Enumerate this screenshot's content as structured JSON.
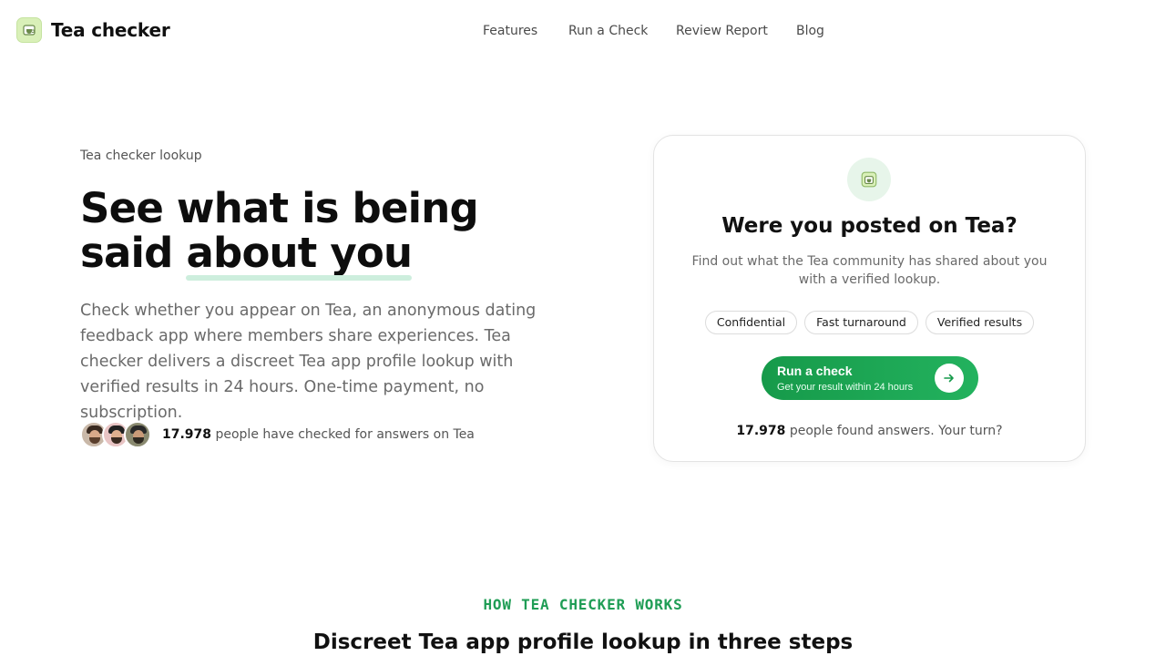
{
  "brand": {
    "name": "Tea checker",
    "icon": "teacup-icon"
  },
  "nav": [
    {
      "label": "Features"
    },
    {
      "label": "Run a Check"
    },
    {
      "label": "Review Report"
    },
    {
      "label": "Blog"
    }
  ],
  "hero": {
    "eyebrow": "Tea checker lookup",
    "title_line1": "See what is being",
    "title_line2_prefix": "said ",
    "title_highlight": "about you",
    "description": "Check whether you appear on Tea, an anonymous dating feedback app where members share experiences. Tea checker delivers a discreet Tea app profile lookup with verified results in 24 hours. One-time payment, no subscription.",
    "social_count": "17.978",
    "social_text": " people have checked for answers on Tea"
  },
  "card": {
    "icon": "teacup-icon",
    "title": "Were you posted on Tea?",
    "description": "Find out what the Tea community has shared about you with a verified lookup.",
    "chips": [
      "Confidential",
      "Fast turnaround",
      "Verified results"
    ],
    "cta_label": "Run a check",
    "cta_sub": "Get your result within 24 hours",
    "cta_icon": "arrow-right-icon",
    "footer_count": "17.978",
    "footer_text": " people found answers. Your turn?"
  },
  "how": {
    "eyebrow": "HOW TEA CHECKER WORKS",
    "title": "Discreet Tea app profile lookup in three steps"
  },
  "colors": {
    "accent": "#1f9d55",
    "cta_start": "#169a4a",
    "cta_end": "#23b25e",
    "highlight": "#cdeedd",
    "logo_bg": "#d9f0b8"
  }
}
